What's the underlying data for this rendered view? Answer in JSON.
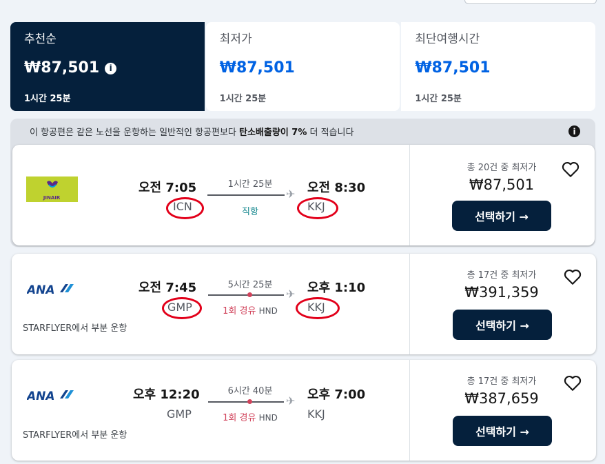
{
  "sort_tabs": [
    {
      "label": "추천순",
      "price": "₩87,501",
      "duration": "1시간 25분"
    },
    {
      "label": "최저가",
      "price": "₩87,501",
      "duration": "1시간 25분"
    },
    {
      "label": "최단여행시간",
      "price": "₩87,501",
      "duration": "1시간 25분"
    }
  ],
  "eco_banner": {
    "text_before": "이 항공편은 같은 노선을 운항하는 일반적인 항공편보다 ",
    "text_bold": "탄소배출량이 7%",
    "text_after": " 더 적습니다",
    "info": "i"
  },
  "flights": [
    {
      "airline_logo": "jinair-logo",
      "airline_logo_text": "JINAIR",
      "dep_time": "오전 7:05",
      "dep_code": "ICN",
      "duration": "1시간 25분",
      "stops": "직항",
      "via": "",
      "arr_time": "오전 8:30",
      "arr_code": "KKJ",
      "operated_by": "",
      "deal_count": "총 20건 중 최저가",
      "price": "₩87,501",
      "select_label": "선택하기 →"
    },
    {
      "airline_logo": "ana-logo",
      "airline_logo_text": "ANA",
      "dep_time": "오전 7:45",
      "dep_code": "GMP",
      "duration": "5시간 25분",
      "stops": "1회 경유",
      "via": "HND",
      "arr_time": "오후 1:10",
      "arr_code": "KKJ",
      "operated_by": "STARFLYER에서 부분 운항",
      "deal_count": "총 17건 중 최저가",
      "price": "₩391,359",
      "select_label": "선택하기 →"
    },
    {
      "airline_logo": "ana-logo",
      "airline_logo_text": "ANA",
      "dep_time": "오후 12:20",
      "dep_code": "GMP",
      "duration": "6시간 40분",
      "stops": "1회 경유",
      "via": "HND",
      "arr_time": "오후 7:00",
      "arr_code": "KKJ",
      "operated_by": "STARFLYER에서 부분 운항",
      "deal_count": "총 17건 중 최저가",
      "price": "₩387,659",
      "select_label": "선택하기 →"
    }
  ],
  "colors": {
    "navy": "#05203c",
    "blue": "#0062e3",
    "direct": "#0c838a",
    "stop": "#d1435b",
    "annotation": "#e2001a"
  }
}
